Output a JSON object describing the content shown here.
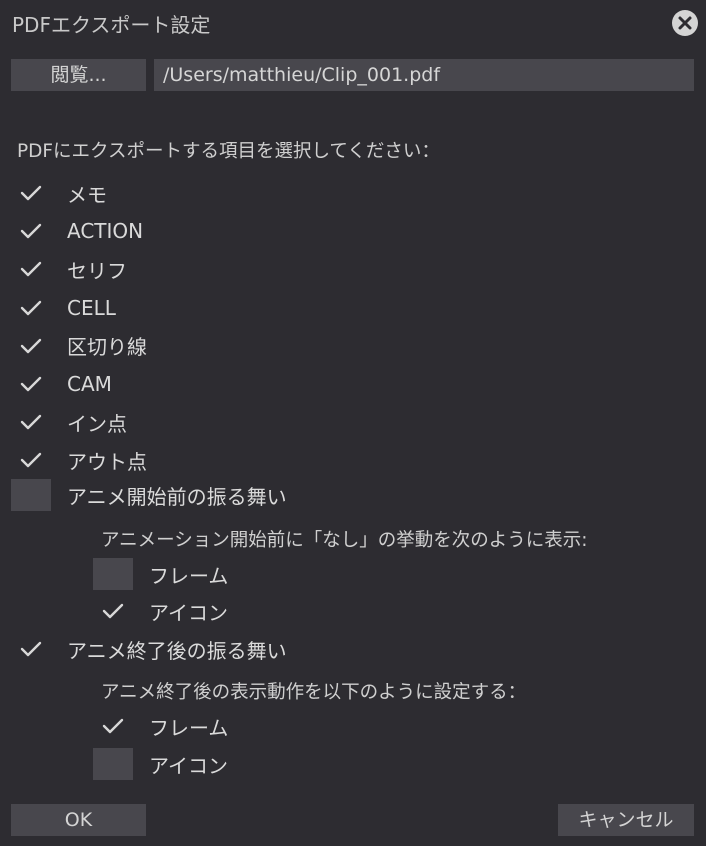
{
  "dialog": {
    "title": "PDFエクスポート設定"
  },
  "browse": {
    "label": "閲覧...",
    "path": "/Users/matthieu/Clip_001.pdf"
  },
  "prompt": "PDFにエクスポートする項目を選択してください：",
  "items": [
    {
      "label": "メモ",
      "checked": true
    },
    {
      "label": "ACTION",
      "checked": true
    },
    {
      "label": "セリフ",
      "checked": true
    },
    {
      "label": "CELL",
      "checked": true
    },
    {
      "label": "区切り線",
      "checked": true
    },
    {
      "label": "CAM",
      "checked": true
    },
    {
      "label": "イン点",
      "checked": true
    },
    {
      "label": "アウト点",
      "checked": true
    }
  ],
  "before_start": {
    "label": "アニメ開始前の振る舞い",
    "checked": false,
    "description": "アニメーション開始前に「なし」の挙動を次のように表示:",
    "options": [
      {
        "label": "フレーム",
        "checked": false
      },
      {
        "label": "アイコン",
        "checked": true
      }
    ]
  },
  "after_end": {
    "label": "アニメ終了後の振る舞い",
    "checked": true,
    "description": "アニメ終了後の表示動作を以下のように設定する：",
    "options": [
      {
        "label": "フレーム",
        "checked": true
      },
      {
        "label": "アイコン",
        "checked": false
      }
    ]
  },
  "buttons": {
    "ok": "OK",
    "cancel": "キャンセル"
  },
  "colors": {
    "background": "#2d2c31",
    "field": "#48474d",
    "text": "#d6d6d6"
  }
}
